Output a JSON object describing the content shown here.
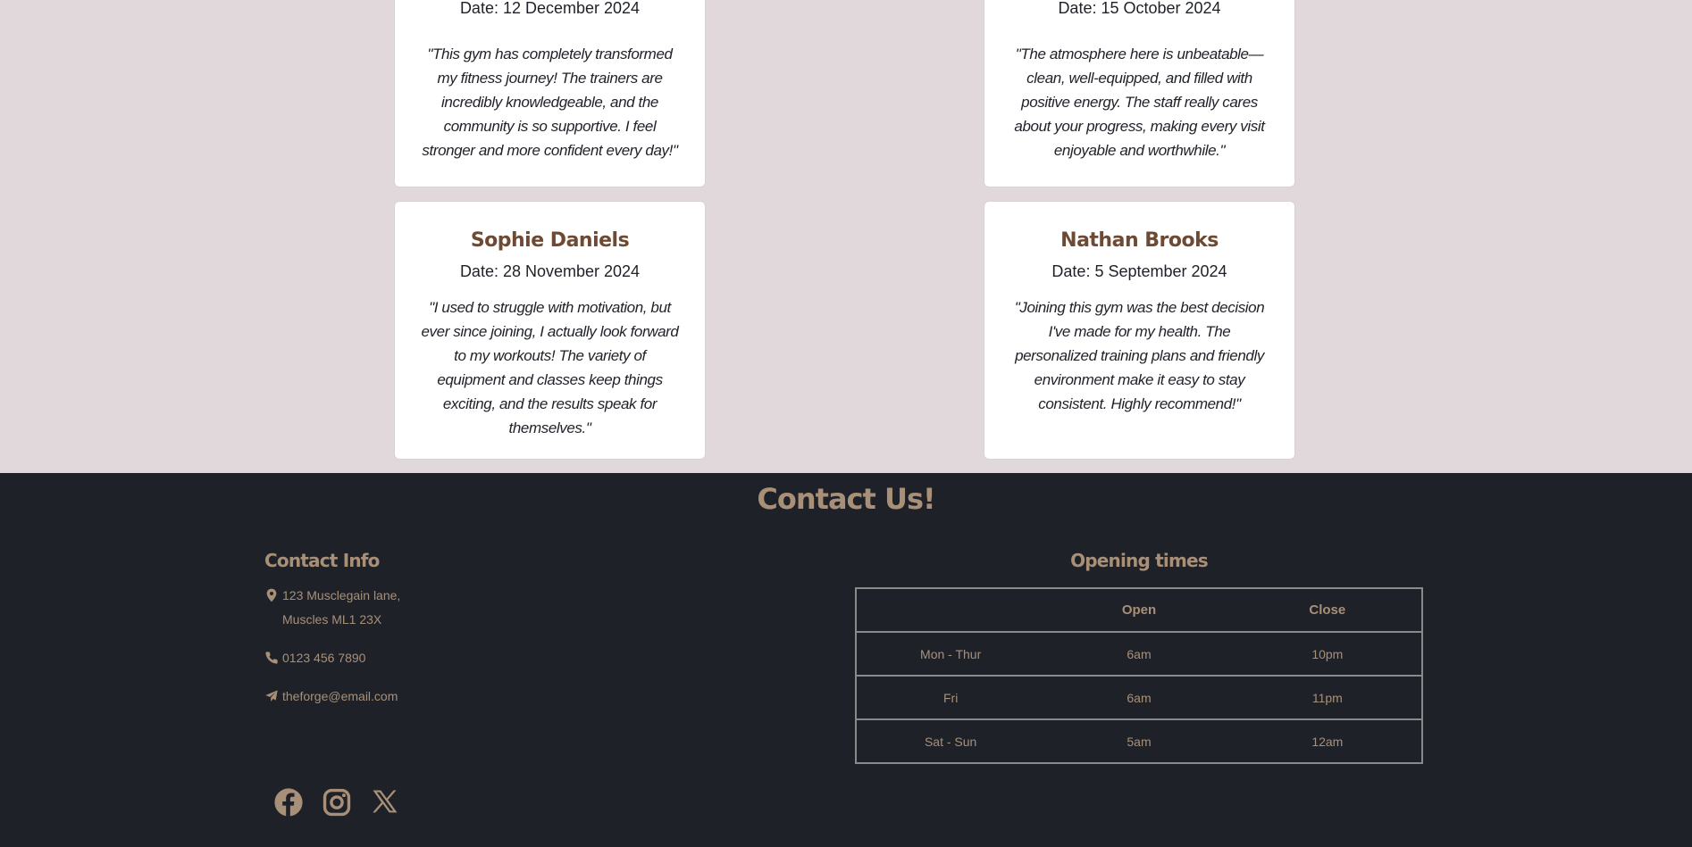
{
  "testimonials": [
    {
      "name": "",
      "date": "Date: 12 December 2024",
      "quote": "\"This gym has completely transformed my fitness journey! The trainers are incredibly knowledgeable, and the community is so supportive. I feel stronger and more confident every day!\""
    },
    {
      "name": "",
      "date": "Date: 15 October 2024",
      "quote": "\"The atmosphere here is unbeatable—clean, well-equipped, and filled with positive energy. The staff really cares about your progress, making every visit enjoyable and worthwhile.\""
    },
    {
      "name": "Sophie Daniels",
      "date": "Date: 28 November 2024",
      "quote": "\"I used to struggle with motivation, but ever since joining, I actually look forward to my workouts! The variety of equipment and classes keep things exciting, and the results speak for themselves.\""
    },
    {
      "name": "Nathan Brooks",
      "date": "Date: 5 September 2024",
      "quote": "\"Joining this gym was the best decision I've made for my health. The personalized training plans and friendly environment make it easy to stay consistent. Highly recommend!\""
    }
  ],
  "footer": {
    "heading": "Contact Us!",
    "contact_info": {
      "title": "Contact Info",
      "address_line1": "123 Musclegain lane,",
      "address_line2": "Muscles ML1 23X",
      "phone": "0123 456 7890",
      "email": "theforge@email.com"
    },
    "opening_times": {
      "title": "Opening times",
      "headers": [
        "",
        "Open",
        "Close"
      ],
      "rows": [
        [
          "Mon - Thur",
          "6am",
          "10pm"
        ],
        [
          "Fri",
          "6am",
          "11pm"
        ],
        [
          "Sat - Sun",
          "5am",
          "12am"
        ]
      ]
    },
    "socials": [
      "facebook-icon",
      "instagram-icon",
      "x-icon"
    ]
  },
  "colors": {
    "page_bg": "#e0d8da",
    "footer_bg": "#1f2128",
    "accent": "#a89078",
    "name_color": "#6e4a35"
  }
}
